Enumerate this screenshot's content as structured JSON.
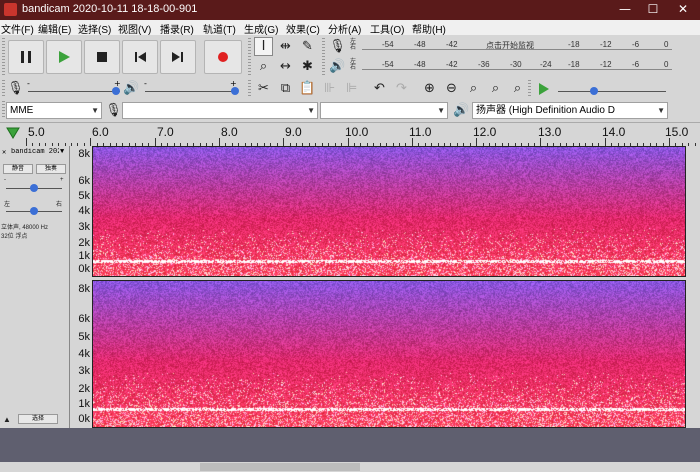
{
  "window": {
    "title": "bandicam 2020-10-11 18-18-00-901",
    "min": "—",
    "max": "☐",
    "close": "✕"
  },
  "menu": [
    "文件(F)",
    "编辑(E)",
    "选择(S)",
    "视图(V)",
    "播录(R)",
    "轨道(T)",
    "生成(G)",
    "效果(C)",
    "分析(A)",
    "工具(O)",
    "帮助(H)"
  ],
  "transport": {
    "pause_icon": "pause-icon",
    "play_icon": "play-icon",
    "stop_icon": "stop-icon",
    "skip_start_icon": "skip-to-start-icon",
    "skip_end_icon": "skip-to-end-icon",
    "record_icon": "record-icon",
    "play_color": "#3ba23b",
    "record_color": "#e02020"
  },
  "meters": {
    "record_ticks": [
      "-54",
      "-48",
      "-42",
      "点击开始监视",
      "-18",
      "-12",
      "-6",
      "0"
    ],
    "play_ticks": [
      "-54",
      "-48",
      "-42",
      "-36",
      "-30",
      "-24",
      "-18",
      "-12",
      "-6",
      "0"
    ],
    "left_label": "左",
    "right_label": "右"
  },
  "mixer": {
    "minus": "-",
    "plus": "+"
  },
  "devices": {
    "host": "MME",
    "output": "扬声器 (High Definition Audio D"
  },
  "timeline": {
    "labels": [
      "5.0",
      "6.0",
      "7.0",
      "8.0",
      "9.0",
      "10.0",
      "11.0",
      "12.0",
      "13.0",
      "14.0",
      "15.0"
    ]
  },
  "track": {
    "close": "✕",
    "name": "bandicam 202",
    "menu_arrow": "▼",
    "mute_label": "静音",
    "solo_label": "独奏",
    "pan_left": "左",
    "pan_right": "右",
    "info_line1": "立体声, 48000 Hz",
    "info_line2": "32位 浮点",
    "collapse": "▲",
    "select_label": "选择"
  },
  "scale": [
    "8k",
    "6k",
    "5k",
    "4k",
    "3k",
    "2k",
    "1k",
    "0k"
  ],
  "colors": {
    "spectrum_top": "#8a55e0",
    "spectrum_mid": "#e0286a",
    "spectrum_low": "#ff3a55",
    "noise_band": "#ffffff"
  }
}
